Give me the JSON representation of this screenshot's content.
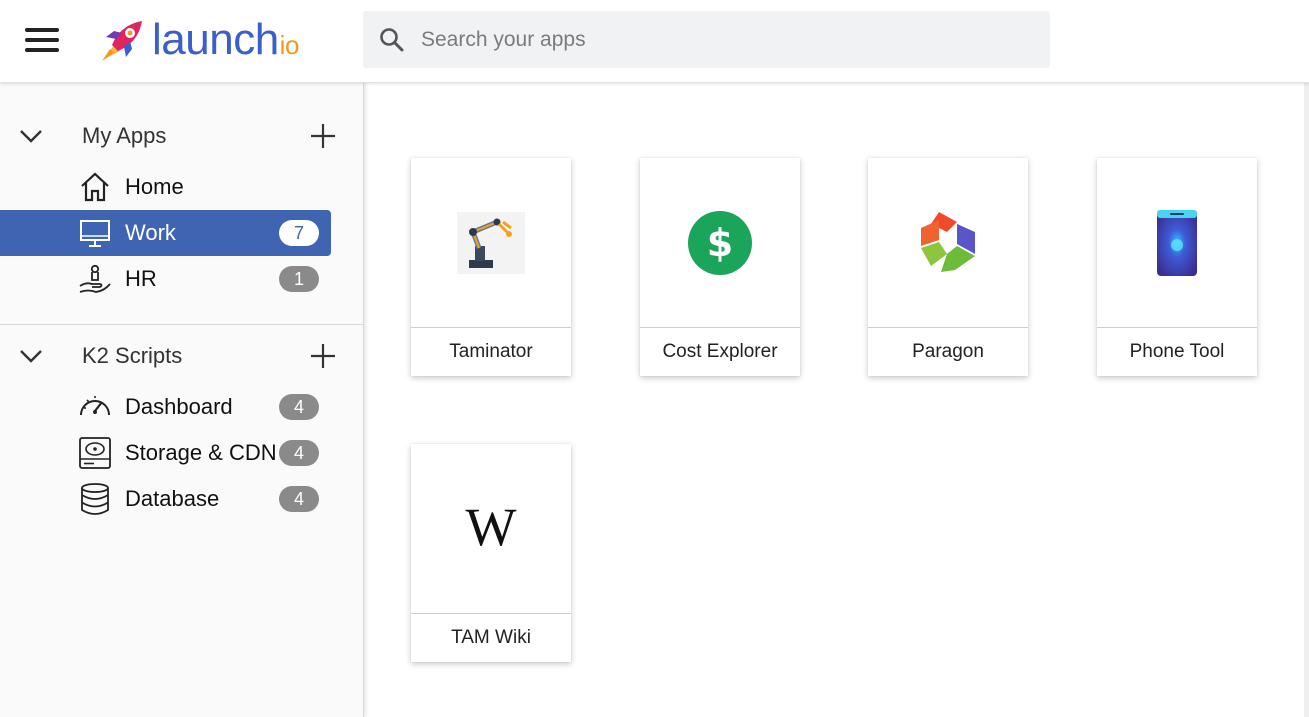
{
  "header": {
    "logo": {
      "word": "launch",
      "suffix": "io"
    },
    "search": {
      "placeholder": "Search your apps",
      "value": ""
    }
  },
  "sidebar": {
    "sections": [
      {
        "title": "My Apps",
        "items": [
          {
            "label": "Home",
            "icon": "home-icon",
            "badge": ""
          },
          {
            "label": "Work",
            "icon": "monitor-icon",
            "badge": "7",
            "active": true
          },
          {
            "label": "HR",
            "icon": "hand-icon",
            "badge": "1"
          }
        ]
      },
      {
        "title": "K2 Scripts",
        "items": [
          {
            "label": "Dashboard",
            "icon": "speedometer-icon",
            "badge": "4"
          },
          {
            "label": "Storage & CDN",
            "icon": "hard-drive-icon",
            "badge": "4"
          },
          {
            "label": "Database",
            "icon": "database-icon",
            "badge": "4"
          }
        ]
      }
    ]
  },
  "apps": [
    {
      "name": "Taminator",
      "icon": "robot-arm-icon"
    },
    {
      "name": "Cost Explorer",
      "icon": "dollar-icon"
    },
    {
      "name": "Paragon",
      "icon": "paragon-logo-icon"
    },
    {
      "name": "Phone Tool",
      "icon": "phone-icon"
    },
    {
      "name": "TAM Wiki",
      "icon": "wikipedia-icon"
    }
  ],
  "colors": {
    "brand_blue": "#3f64b1",
    "logo_blue": "#3a5fcd",
    "logo_orange": "#f39a1e",
    "badge_gray": "#8a8a8a",
    "dollar_green": "#1aa55a"
  }
}
